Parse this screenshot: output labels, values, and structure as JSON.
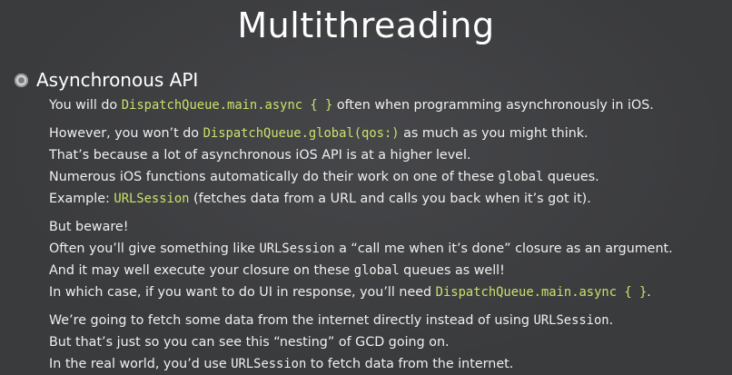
{
  "title": "Multithreading",
  "heading": "Asynchronous API",
  "colors": {
    "background": "#3a3b3d",
    "text": "#f0f0f0",
    "code_highlight": "#c9e26a"
  },
  "lines": {
    "l1": {
      "a": "You will do ",
      "code": "DispatchQueue.main.async { }",
      "b": " often when programming asynchronously in iOS."
    },
    "l2": {
      "a": "However, you won’t do ",
      "code": "DispatchQueue.global(qos:)",
      "b": " as much as you might think."
    },
    "l3": {
      "text": "That’s because a lot of asynchronous iOS API is at a higher level."
    },
    "l4": {
      "a": "Numerous iOS functions automatically do their work on one of these ",
      "code": "global",
      "b": " queues."
    },
    "l5": {
      "a": "Example: ",
      "code": "URLSession",
      "b": " (fetches data from a URL and calls you back when it’s got it)."
    },
    "l6": {
      "text": "But beware!"
    },
    "l7": {
      "a": "Often you’ll give something like ",
      "code": "URLSession",
      "b": " a “call me when it’s done” closure as an argument."
    },
    "l8": {
      "a": "And it may well execute your closure on these ",
      "code": "global",
      "b": " queues as well!"
    },
    "l9": {
      "a": "In which case, if you want to do UI in response, you’ll need ",
      "code": "DispatchQueue.main.async { }",
      "b": "."
    },
    "l10": {
      "a": "We’re going to fetch some data from the internet directly instead of using ",
      "code": "URLSession",
      "b": "."
    },
    "l11": {
      "text": "But that’s just so you can see this “nesting” of GCD going on."
    },
    "l12": {
      "a": "In the real world, you’d use ",
      "code": "URLSession",
      "b": " to fetch data from the internet."
    }
  }
}
